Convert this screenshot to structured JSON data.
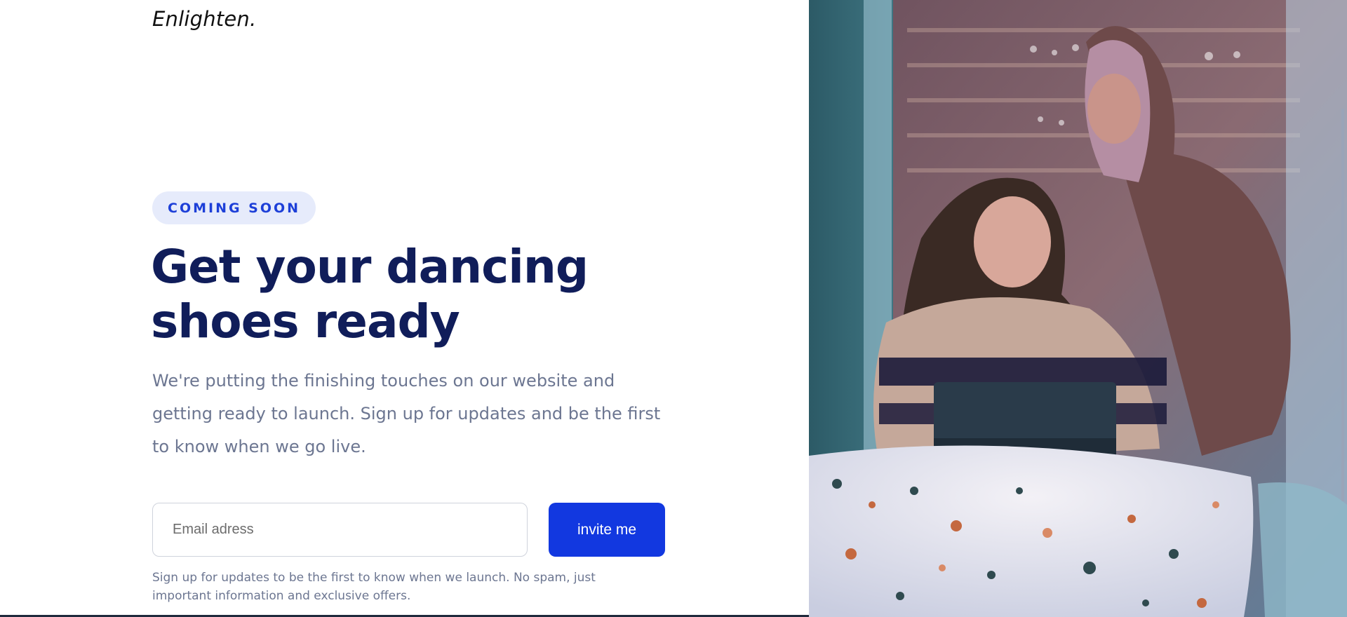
{
  "brand": {
    "logo_text": "Enlighten."
  },
  "hero": {
    "badge": "COMING SOON",
    "headline_line1": "Get your dancing",
    "headline_line2": "shoes ready",
    "description": "We're putting the finishing touches on our website and getting ready to launch. Sign up for updates and be the first to know when we go live."
  },
  "signup": {
    "email_placeholder": "Email adress",
    "email_value": "",
    "button_label": "invite me",
    "disclaimer": "Sign up for updates to be the first to know when we launch. No spam, just important information and exclusive offers."
  },
  "colors": {
    "accent": "#1238e0",
    "headline": "#101d5a",
    "badge_bg": "#e6ebfb",
    "body_text": "#6c7691"
  },
  "image": {
    "subject": "two women looking at a laptop at a terrazzo cafe table"
  }
}
